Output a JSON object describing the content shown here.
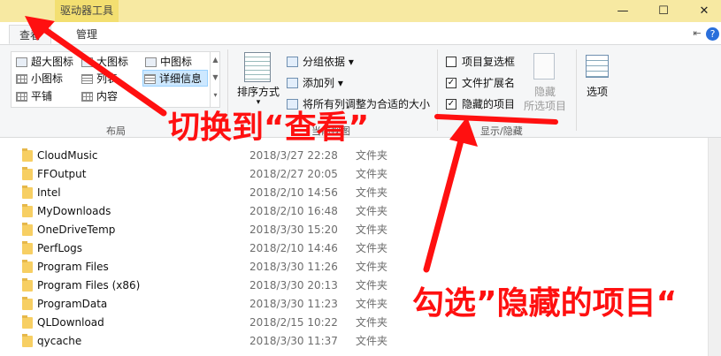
{
  "titlebar": {
    "context_tab": "驱动器工具",
    "minimize": "—",
    "maximize": "☐",
    "close": "✕"
  },
  "tabs": {
    "view": "查看",
    "manage": "管理"
  },
  "ribbon_controls": {
    "pin": "⇤",
    "help": "?"
  },
  "layout_group": {
    "label": "布局",
    "items": [
      "超大图标",
      "大图标",
      "中图标",
      "小图标",
      "列表",
      "详细信息",
      "平铺",
      "内容"
    ],
    "selected": "详细信息"
  },
  "current_view_group": {
    "sort_label": "排序方式",
    "group_by": "分组依据",
    "add_column": "添加列",
    "fit_columns": "将所有列调整为合适的大小",
    "label": "当前视图"
  },
  "show_hide_group": {
    "label": "显示/隐藏",
    "checkboxes": [
      {
        "label": "项目复选框",
        "checked": false
      },
      {
        "label": "文件扩展名",
        "checked": true
      },
      {
        "label": "隐藏的项目",
        "checked": true
      }
    ],
    "hide_selected_1": "隐藏",
    "hide_selected_2": "所选项目"
  },
  "options_label": "选项",
  "files": [
    {
      "name": "CloudMusic",
      "date": "2018/3/27 22:28",
      "type": "文件夹"
    },
    {
      "name": "FFOutput",
      "date": "2018/2/27 20:05",
      "type": "文件夹"
    },
    {
      "name": "Intel",
      "date": "2018/2/10 14:56",
      "type": "文件夹"
    },
    {
      "name": "MyDownloads",
      "date": "2018/2/10 16:48",
      "type": "文件夹"
    },
    {
      "name": "OneDriveTemp",
      "date": "2018/3/30 15:20",
      "type": "文件夹"
    },
    {
      "name": "PerfLogs",
      "date": "2018/2/10 14:46",
      "type": "文件夹"
    },
    {
      "name": "Program Files",
      "date": "2018/3/30 11:26",
      "type": "文件夹"
    },
    {
      "name": "Program Files (x86)",
      "date": "2018/3/30 20:13",
      "type": "文件夹"
    },
    {
      "name": "ProgramData",
      "date": "2018/3/30 11:23",
      "type": "文件夹"
    },
    {
      "name": "QLDownload",
      "date": "2018/2/15 10:22",
      "type": "文件夹"
    },
    {
      "name": "qycache",
      "date": "2018/3/30 11:37",
      "type": "文件夹"
    }
  ],
  "annotations": {
    "switch_to_view": "切换到“查看”",
    "check_hidden": "勾选”隐藏的项目“"
  },
  "colors": {
    "titlebar": "#f7e9a2",
    "context_tab": "#f3df71",
    "ribbon": "#f5f6f7",
    "annotation": "#ff1010",
    "folder": "#f7cf63"
  }
}
